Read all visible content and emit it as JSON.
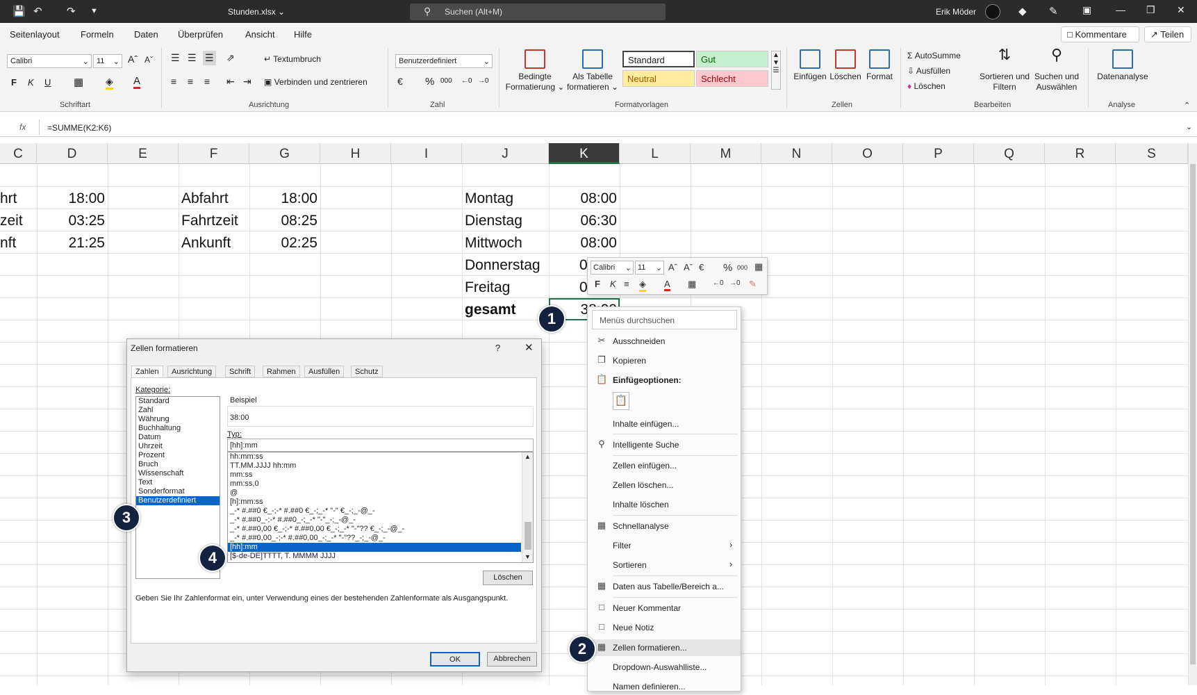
{
  "titlebar": {
    "filename": "Stunden.xlsx ⌄",
    "search_placeholder": "Suchen (Alt+M)",
    "user": "Erik Möder"
  },
  "menu": {
    "tabs": [
      "Seitenlayout",
      "Formeln",
      "Daten",
      "Überprüfen",
      "Ansicht",
      "Hilfe"
    ],
    "comments": "Kommentare",
    "share": "Teilen"
  },
  "ribbon": {
    "font_name": "Calibri",
    "font_size": "11",
    "wrap_text": "Textumbruch",
    "merge_center": "Verbinden und zentrieren",
    "number_format": "Benutzerdefiniert",
    "cond_format": "Bedingte Formatierung ⌄",
    "as_table": "Als Tabelle formatieren ⌄",
    "styles": {
      "standard": "Standard",
      "gut": "Gut",
      "neutral": "Neutral",
      "schlecht": "Schlecht"
    },
    "insert": "Einfügen",
    "delete": "Löschen",
    "format": "Format",
    "autosum": "AutoSumme",
    "fill": "Ausfüllen",
    "clear": "Löschen",
    "sort_filter": "Sortieren und Filtern",
    "find_select": "Suchen und Auswählen",
    "analyze": "Datenanalyse",
    "groups": {
      "font": "Schriftart",
      "align": "Ausrichtung",
      "number": "Zahl",
      "styles": "Formatvorlagen",
      "cells": "Zellen",
      "edit": "Bearbeiten",
      "analysis": "Analyse"
    },
    "bold": "F",
    "italic": "K",
    "underline": "U"
  },
  "formulabar": {
    "fx": "fx",
    "formula": "=SUMME(K2:K6)"
  },
  "columns": [
    "C",
    "D",
    "E",
    "F",
    "G",
    "H",
    "I",
    "J",
    "K",
    "L",
    "M",
    "N",
    "O",
    "P",
    "Q",
    "R",
    "S"
  ],
  "cells": {
    "c2": "hrt",
    "c3": "zeit",
    "c4": "nft",
    "d2": "18:00",
    "d3": "03:25",
    "d4": "21:25",
    "f2": "Abfahrt",
    "f3": "Fahrtzeit",
    "f4": "Ankunft",
    "g2": "18:00",
    "g3": "08:25",
    "g4": "02:25",
    "j2": "Montag",
    "j3": "Dienstag",
    "j4": "Mittwoch",
    "j5": "Donnerstag",
    "j6": "Freitag",
    "j7": "gesamt",
    "k2": "08:00",
    "k3": "06:30",
    "k4": "08:00",
    "k5": "0",
    "k6": "0",
    "k7": "38:00"
  },
  "minitoolbar": {
    "font": "Calibri",
    "size": "11",
    "bold": "F",
    "italic": "K"
  },
  "dialog": {
    "title": "Zellen formatieren",
    "help": "?",
    "close": "✕",
    "tabs": [
      "Zahlen",
      "Ausrichtung",
      "Schrift",
      "Rahmen",
      "Ausfüllen",
      "Schutz"
    ],
    "category_label": "Kategorie:",
    "categories": [
      "Standard",
      "Zahl",
      "Währung",
      "Buchhaltung",
      "Datum",
      "Uhrzeit",
      "Prozent",
      "Bruch",
      "Wissenschaft",
      "Text",
      "Sonderformat",
      "Benutzerdefiniert"
    ],
    "sample_label": "Beispiel",
    "sample_value": "38:00",
    "type_label": "Typ:",
    "type_value": "[hh]:mm",
    "formats": [
      "hh:mm:ss",
      "TT.MM.JJJJ hh:mm",
      "mm:ss",
      "mm:ss,0",
      "@",
      "[h]:mm:ss",
      "_-* #.##0 €_-;-* #.##0 €_-;_-* \"-\" €_-;_-@_-",
      "_-* #.##0_-;-* #.##0_-;_-* \"-\"_-;_-@_-",
      "_-* #.##0,00 €_-;-* #.##0,00 €_-;_-* \"-\"?? €_-;_-@_-",
      "_-* #.##0,00_-;-* #.##0,00_-;_-* \"-\"??_-;_-@_-",
      "[hh]:mm",
      "[$-de-DE]TTTT, T. MMMM JJJJ"
    ],
    "delete_button": "Löschen",
    "hint": "Geben Sie Ihr Zahlenformat ein, unter Verwendung eines der bestehenden Zahlenformate als Ausgangspunkt.",
    "ok": "OK",
    "cancel": "Abbrechen"
  },
  "context_menu": {
    "search": "Menüs durchsuchen",
    "cut": "Ausschneiden",
    "copy": "Kopieren",
    "paste_options": "Einfügeoptionen:",
    "paste_special": "Inhalte einfügen...",
    "smart_lookup": "Intelligente Suche",
    "insert_cells": "Zellen einfügen...",
    "delete_cells": "Zellen löschen...",
    "clear_contents": "Inhalte löschen",
    "quick_analysis": "Schnellanalyse",
    "filter": "Filter",
    "sort": "Sortieren",
    "from_table": "Daten aus Tabelle/Bereich a...",
    "new_comment": "Neuer Kommentar",
    "new_note": "Neue Notiz",
    "format_cells": "Zellen formatieren...",
    "dropdown_list": "Dropdown-Auswahlliste...",
    "define_name": "Namen definieren..."
  },
  "badges": [
    "1",
    "2",
    "3",
    "4"
  ]
}
